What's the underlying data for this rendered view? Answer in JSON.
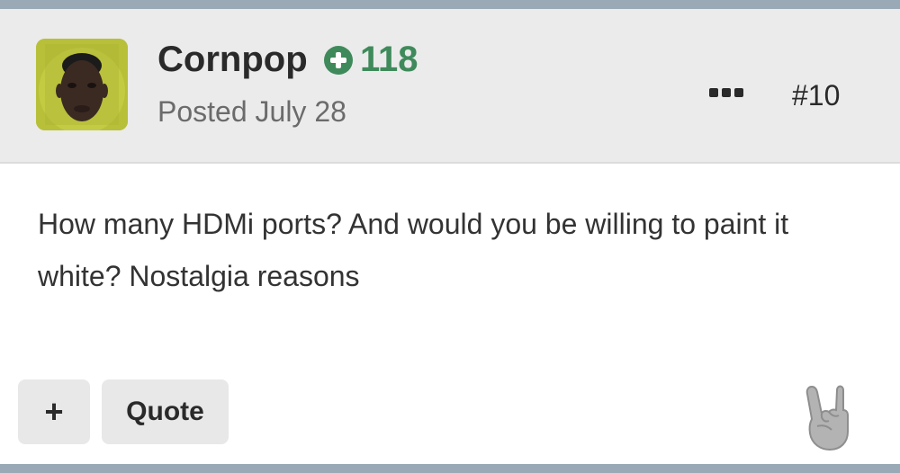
{
  "post": {
    "author": "Cornpop",
    "reputation": "118",
    "posted": "Posted July 28",
    "post_number": "#10",
    "content": "How many HDMi ports? And would you be willing to paint it white? Nostalgia reasons"
  },
  "actions": {
    "plus_label": "+",
    "quote_label": "Quote"
  },
  "icons": {
    "reputation": "plus-circle-icon",
    "more": "ellipsis-icon",
    "reaction": "rock-hand-icon"
  },
  "colors": {
    "reputation": "#3f8a5a",
    "header_bg": "#ebebeb",
    "button_bg": "#e8e8e8"
  }
}
